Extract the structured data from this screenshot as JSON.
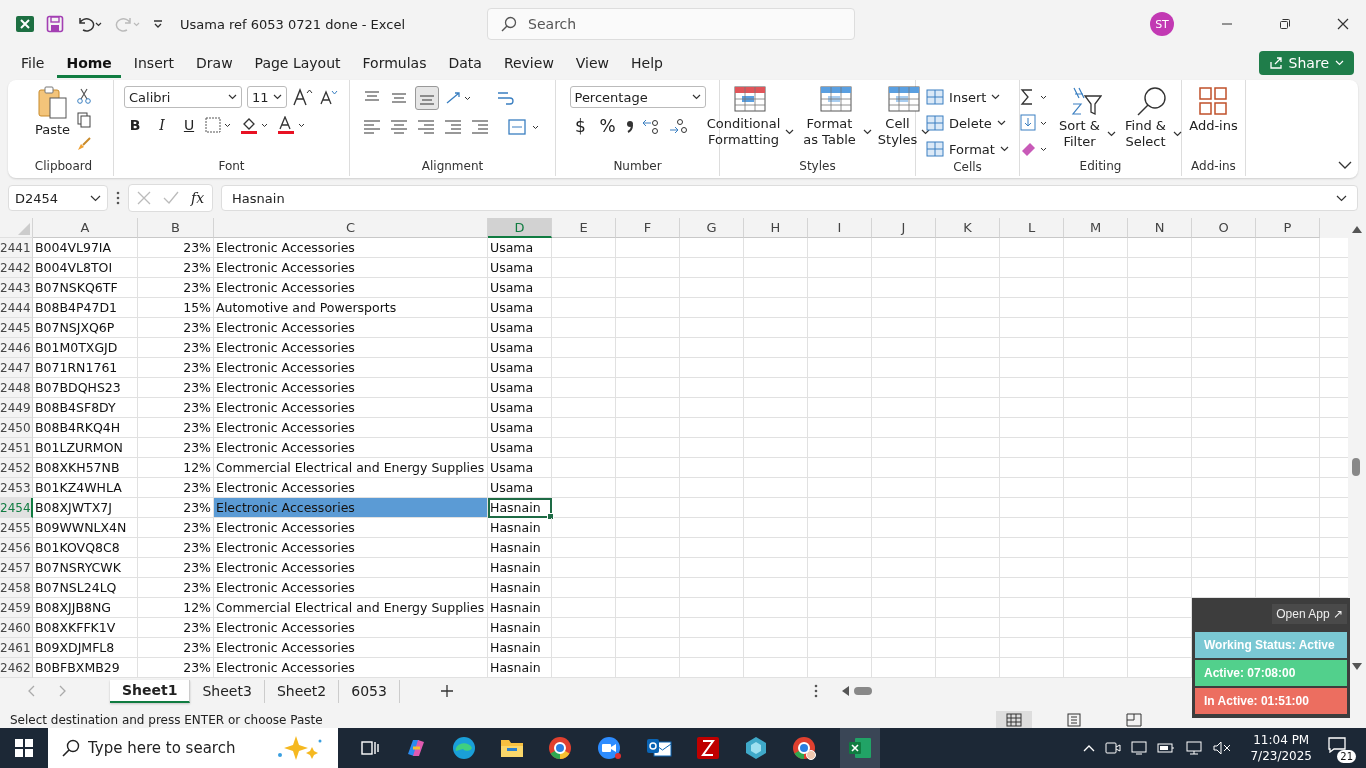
{
  "window": {
    "title": "Usama ref 6053 0721 done  -  Excel",
    "search_placeholder": "Search",
    "user_initials": "ST"
  },
  "menu": [
    {
      "label": "File",
      "selected": false
    },
    {
      "label": "Home",
      "selected": true
    },
    {
      "label": "Insert",
      "selected": false
    },
    {
      "label": "Draw",
      "selected": false
    },
    {
      "label": "Page Layout",
      "selected": false
    },
    {
      "label": "Formulas",
      "selected": false
    },
    {
      "label": "Data",
      "selected": false
    },
    {
      "label": "Review",
      "selected": false
    },
    {
      "label": "View",
      "selected": false
    },
    {
      "label": "Help",
      "selected": false
    }
  ],
  "share": "Share",
  "ribbon": {
    "clipboard": {
      "paste": "Paste",
      "label": "Clipboard"
    },
    "font": {
      "name": "Calibri",
      "size": "11",
      "styles": [
        "B",
        "I",
        "U"
      ],
      "label": "Font"
    },
    "alignment": {
      "label": "Alignment"
    },
    "number": {
      "format": "Percentage",
      "symbols": [
        "$",
        "%"
      ],
      "label": "Number"
    },
    "styles": {
      "buttons": [
        "Conditional Formatting",
        "Format as Table",
        "Cell Styles"
      ],
      "label": "Styles"
    },
    "cells": {
      "buttons": [
        "Insert",
        "Delete",
        "Format"
      ],
      "label": "Cells"
    },
    "editing": {
      "buttons": [
        "Sort & Filter",
        "Find & Select"
      ],
      "label": "Editing"
    },
    "addins": {
      "button": "Add-ins",
      "label": "Add-ins"
    }
  },
  "formula_bar": {
    "name_box": "D2454",
    "function_label": "fx",
    "value": "Hasnain"
  },
  "columns": [
    {
      "label": "A",
      "selected": false
    },
    {
      "label": "B",
      "selected": false
    },
    {
      "label": "C",
      "selected": false
    },
    {
      "label": "D",
      "selected": true
    },
    {
      "label": "E",
      "selected": false
    },
    {
      "label": "F",
      "selected": false
    },
    {
      "label": "G",
      "selected": false
    },
    {
      "label": "H",
      "selected": false
    },
    {
      "label": "I",
      "selected": false
    },
    {
      "label": "J",
      "selected": false
    },
    {
      "label": "K",
      "selected": false
    },
    {
      "label": "L",
      "selected": false
    },
    {
      "label": "M",
      "selected": false
    },
    {
      "label": "N",
      "selected": false
    },
    {
      "label": "O",
      "selected": false
    },
    {
      "label": "P",
      "selected": false
    }
  ],
  "rows": [
    {
      "row": "2441",
      "cells": [
        "B004VL97IA",
        "23%",
        "Electronic Accessories",
        "Usama"
      ],
      "selected": false
    },
    {
      "row": "2442",
      "cells": [
        "B004VL8TOI",
        "23%",
        "Electronic Accessories",
        "Usama"
      ],
      "selected": false
    },
    {
      "row": "2443",
      "cells": [
        "B07NSKQ6TF",
        "23%",
        "Electronic Accessories",
        "Usama"
      ],
      "selected": false
    },
    {
      "row": "2444",
      "cells": [
        "B08B4P47D1",
        "15%",
        "Automotive and Powersports",
        "Usama"
      ],
      "selected": false
    },
    {
      "row": "2445",
      "cells": [
        "B07NSJXQ6P",
        "23%",
        "Electronic Accessories",
        "Usama"
      ],
      "selected": false
    },
    {
      "row": "2446",
      "cells": [
        "B01M0TXGJD",
        "23%",
        "Electronic Accessories",
        "Usama"
      ],
      "selected": false
    },
    {
      "row": "2447",
      "cells": [
        "B071RN1761",
        "23%",
        "Electronic Accessories",
        "Usama"
      ],
      "selected": false
    },
    {
      "row": "2448",
      "cells": [
        "B07BDQHS23",
        "23%",
        "Electronic Accessories",
        "Usama"
      ],
      "selected": false
    },
    {
      "row": "2449",
      "cells": [
        "B08B4SF8DY",
        "23%",
        "Electronic Accessories",
        "Usama"
      ],
      "selected": false
    },
    {
      "row": "2450",
      "cells": [
        "B08B4RKQ4H",
        "23%",
        "Electronic Accessories",
        "Usama"
      ],
      "selected": false
    },
    {
      "row": "2451",
      "cells": [
        "B01LZURMON",
        "23%",
        "Electronic Accessories",
        "Usama"
      ],
      "selected": false
    },
    {
      "row": "2452",
      "cells": [
        "B08XKH57NB",
        "12%",
        "Commercial Electrical and Energy Supplies",
        "Usama"
      ],
      "selected": false
    },
    {
      "row": "2453",
      "cells": [
        "B01KZ4WHLA",
        "23%",
        "Electronic Accessories",
        "Usama"
      ],
      "selected": false
    },
    {
      "row": "2454",
      "cells": [
        "B08XJWTX7J",
        "23%",
        "Electronic Accessories",
        "Hasnain"
      ],
      "selected": true
    },
    {
      "row": "2455",
      "cells": [
        "B09WWNLX4N",
        "23%",
        "Electronic Accessories",
        "Hasnain"
      ],
      "selected": false
    },
    {
      "row": "2456",
      "cells": [
        "B01KOVQ8C8",
        "23%",
        "Electronic Accessories",
        "Hasnain"
      ],
      "selected": false
    },
    {
      "row": "2457",
      "cells": [
        "B07NSRYCWK",
        "23%",
        "Electronic Accessories",
        "Hasnain"
      ],
      "selected": false
    },
    {
      "row": "2458",
      "cells": [
        "B07NSL24LQ",
        "23%",
        "Electronic Accessories",
        "Hasnain"
      ],
      "selected": false
    },
    {
      "row": "2459",
      "cells": [
        "B08XJJB8NG",
        "12%",
        "Commercial Electrical and Energy Supplies",
        "Hasnain"
      ],
      "selected": false
    },
    {
      "row": "2460",
      "cells": [
        "B08XKFFK1V",
        "23%",
        "Electronic Accessories",
        "Hasnain"
      ],
      "selected": false
    },
    {
      "row": "2461",
      "cells": [
        "B09XDJMFL8",
        "23%",
        "Electronic Accessories",
        "Hasnain"
      ],
      "selected": false
    },
    {
      "row": "2462",
      "cells": [
        "B0BFBXMB29",
        "23%",
        "Electronic Accessories",
        "Hasnain"
      ],
      "selected": false
    }
  ],
  "sheet_tabs": [
    {
      "label": "Sheet1",
      "selected": true
    },
    {
      "label": "Sheet3",
      "selected": false
    },
    {
      "label": "Sheet2",
      "selected": false
    },
    {
      "label": "6053",
      "selected": false
    }
  ],
  "status_bar": {
    "message": "Select destination and press ENTER or choose Paste"
  },
  "widget": {
    "open_app": "Open App ↗",
    "items": [
      {
        "text": "Working Status: Active",
        "color": "#7ac8d3"
      },
      {
        "text": "Active: 07:08:00",
        "color": "#52d08c"
      },
      {
        "text": "In Active: 01:51:00",
        "color": "#ec6e60"
      }
    ]
  },
  "taskbar": {
    "search_placeholder": "Type here to search",
    "time": "11:04 PM",
    "date": "7/23/2025",
    "notifications": "21"
  }
}
